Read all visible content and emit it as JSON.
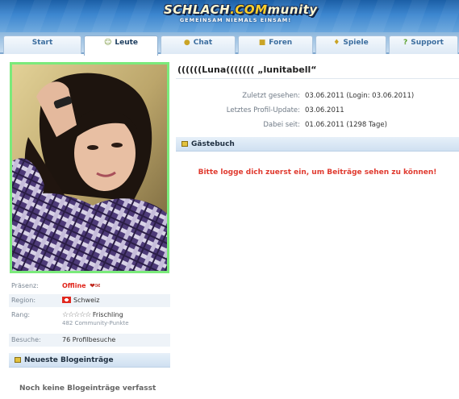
{
  "header": {
    "logo_main": "SCHLACH",
    "logo_accent": ".COM",
    "logo_tail": "munity",
    "slogan": "GEMEINSAM NIEMALS EINSAM!"
  },
  "tabs": [
    {
      "label": "Start",
      "icon": "none",
      "active": false
    },
    {
      "label": "Leute",
      "icon": "people-icon",
      "active": true
    },
    {
      "label": "Chat",
      "icon": "chat-bubble-icon",
      "active": false
    },
    {
      "label": "Foren",
      "icon": "forum-icon",
      "active": false
    },
    {
      "label": "Spiele",
      "icon": "games-icon",
      "active": false
    },
    {
      "label": "Support",
      "icon": "support-icon",
      "active": false
    }
  ],
  "profile": {
    "title": "((((((Luna((((((( „lunitabell“",
    "last_seen_label": "Zuletzt gesehen:",
    "last_seen_value": "03.06.2011 (Login: 03.06.2011)",
    "last_update_label": "Letztes Profil-Update:",
    "last_update_value": "03.06.2011",
    "member_since_label": "Dabei seit:",
    "member_since_value": "01.06.2011 (1298 Tage)"
  },
  "guestbook": {
    "title": "Gästebuch",
    "message": "Bitte logge dich zuerst ein, um Beiträge sehen zu können!"
  },
  "info": {
    "presence_label": "Präsenz:",
    "presence_value": "Offline",
    "region_label": "Region:",
    "region_value": "Schweiz",
    "rank_label": "Rang:",
    "rank_stars": "☆☆☆☆☆",
    "rank_value": "Frischling",
    "rank_points": "482 Community-Punkte",
    "visits_label": "Besuche:",
    "visits_value": "76 Profilbesuche"
  },
  "blog": {
    "title": "Neueste Blogeinträge",
    "empty": "Noch keine Blogeinträge verfasst"
  },
  "colors": {
    "header_blue": "#2f78c2",
    "offline_red": "#e0251b",
    "photo_border": "#7bea7b",
    "message_red": "#e03a2f"
  }
}
